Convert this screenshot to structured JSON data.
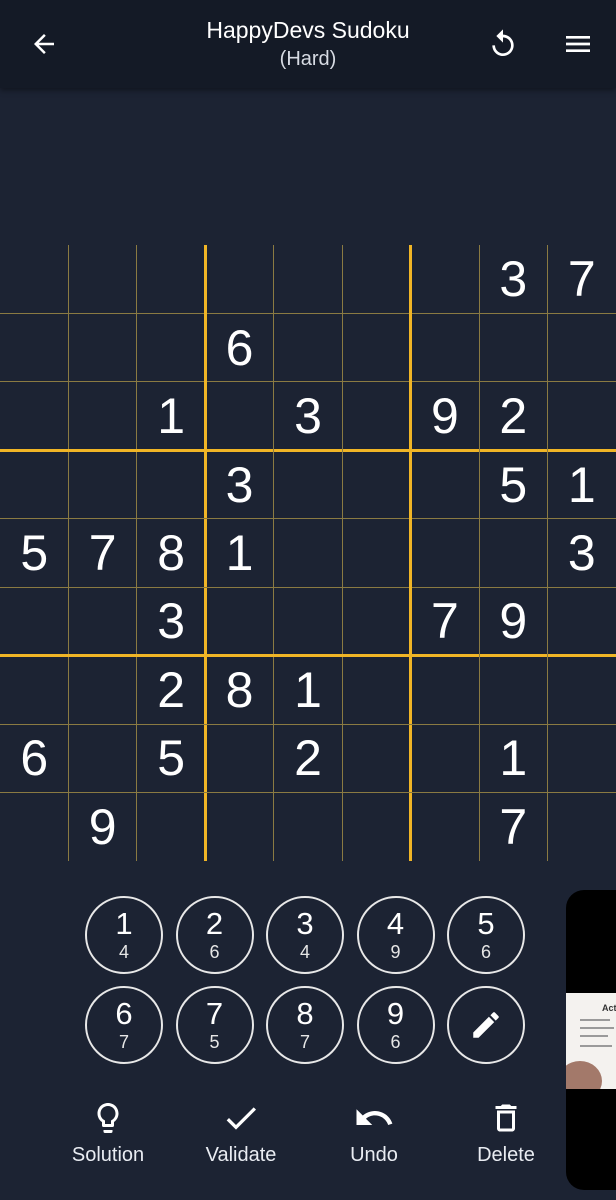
{
  "app_bar": {
    "title": "HappyDevs Sudoku",
    "subtitle": "(Hard)",
    "back_icon": "arrow-left-icon",
    "restart_icon": "restart-icon",
    "menu_icon": "hamburger-menu-icon"
  },
  "colors": {
    "background": "#1c2333",
    "app_bar": "#141a26",
    "grid_thick": "#f0b526",
    "grid_thin": "#8a7a42",
    "text": "#ffffff"
  },
  "board": {
    "cells": [
      [
        "",
        "",
        "",
        "",
        "",
        "",
        "",
        "3",
        "7"
      ],
      [
        "",
        "",
        "",
        "6",
        "",
        "",
        "",
        "",
        ""
      ],
      [
        "",
        "",
        "1",
        "",
        "3",
        "",
        "9",
        "2",
        ""
      ],
      [
        "",
        "",
        "",
        "3",
        "",
        "",
        "",
        "5",
        "1"
      ],
      [
        "5",
        "7",
        "8",
        "1",
        "",
        "",
        "",
        "",
        "3"
      ],
      [
        "",
        "",
        "3",
        "",
        "",
        "",
        "7",
        "9",
        ""
      ],
      [
        "",
        "",
        "2",
        "8",
        "1",
        "",
        "",
        "",
        ""
      ],
      [
        "6",
        "",
        "5",
        "",
        "2",
        "",
        "",
        "1",
        ""
      ],
      [
        "",
        "9",
        "",
        "",
        "",
        "",
        "",
        "7",
        ""
      ]
    ]
  },
  "numpad": {
    "buttons": [
      {
        "digit": "1",
        "remaining": "4"
      },
      {
        "digit": "2",
        "remaining": "6"
      },
      {
        "digit": "3",
        "remaining": "4"
      },
      {
        "digit": "4",
        "remaining": "9"
      },
      {
        "digit": "5",
        "remaining": "6"
      },
      {
        "digit": "6",
        "remaining": "7"
      },
      {
        "digit": "7",
        "remaining": "5"
      },
      {
        "digit": "8",
        "remaining": "7"
      },
      {
        "digit": "9",
        "remaining": "6"
      }
    ],
    "pencil_icon": "pencil-icon"
  },
  "actions": {
    "solution": {
      "label": "Solution",
      "icon": "lightbulb-icon"
    },
    "validate": {
      "label": "Validate",
      "icon": "checkmark-icon"
    },
    "undo": {
      "label": "Undo",
      "icon": "undo-icon"
    },
    "delete": {
      "label": "Delete",
      "icon": "trash-icon"
    }
  },
  "side_preview": {
    "visible_text": "Acti"
  }
}
